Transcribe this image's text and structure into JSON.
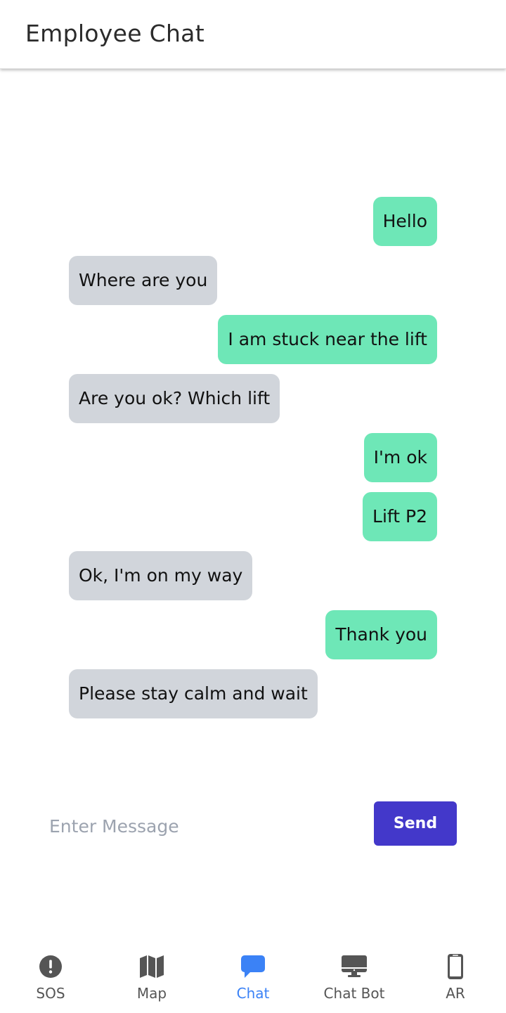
{
  "header": {
    "title": "Employee Chat"
  },
  "messages": [
    {
      "side": "sent",
      "text": "Hello"
    },
    {
      "side": "received",
      "text": "Where are you"
    },
    {
      "side": "sent",
      "text": "I am stuck near the lift"
    },
    {
      "side": "received",
      "text": "Are you ok? Which lift"
    },
    {
      "side": "sent",
      "text": "I'm ok"
    },
    {
      "side": "sent",
      "text": "Lift P2"
    },
    {
      "side": "received",
      "text": "Ok, I'm on my way"
    },
    {
      "side": "sent",
      "text": "Thank you"
    },
    {
      "side": "received",
      "text": "Please stay calm and wait"
    }
  ],
  "composer": {
    "placeholder": "Enter Message",
    "value": "",
    "send_label": "Send"
  },
  "nav": {
    "items": [
      {
        "label": "SOS",
        "icon": "exclamation-circle-icon",
        "active": false
      },
      {
        "label": "Map",
        "icon": "map-icon",
        "active": false
      },
      {
        "label": "Chat",
        "icon": "chat-bubble-icon",
        "active": true
      },
      {
        "label": "Chat Bot",
        "icon": "desktop-icon",
        "active": false
      },
      {
        "label": "AR",
        "icon": "mobile-phone-icon",
        "active": false
      }
    ]
  },
  "colors": {
    "sent_bubble": "#6ee7b7",
    "received_bubble": "#d1d5db",
    "send_button": "#4338ca",
    "nav_active": "#3b82f6",
    "nav_inactive": "#555555"
  }
}
